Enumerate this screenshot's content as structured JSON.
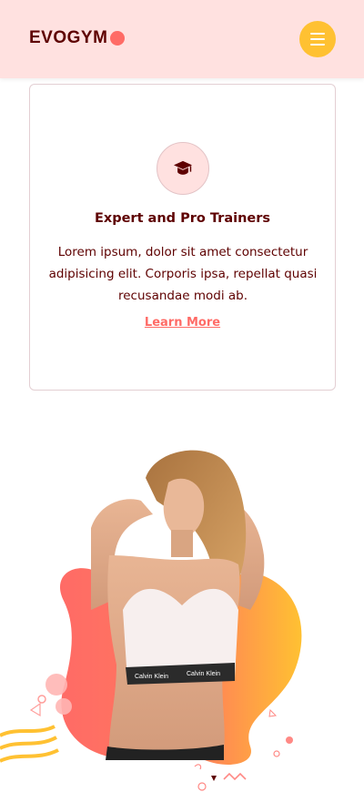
{
  "header": {
    "logo_text": "EVOGYM",
    "brand_color": "#5e0000",
    "background_color": "#ffe1e0",
    "accent_dot_color": "#ff6b66",
    "menu_icon": "hamburger-menu-icon",
    "menu_button_color": "#ffc132"
  },
  "benefit_card": {
    "icon": "graduation-cap-icon",
    "title": "Expert and Pro Trainers",
    "description": "Lorem ipsum, dolor sit amet consectetur adipisicing elit. Corporis ipsa, repellat quasi recusandae modi ab.",
    "link_label": "Learn More",
    "link_color": "#ff6b66"
  },
  "hero_image": {
    "subject": "woman-in-sports-bra",
    "blob_gradient_from": "#ff6b66",
    "blob_gradient_to": "#ffc132"
  }
}
